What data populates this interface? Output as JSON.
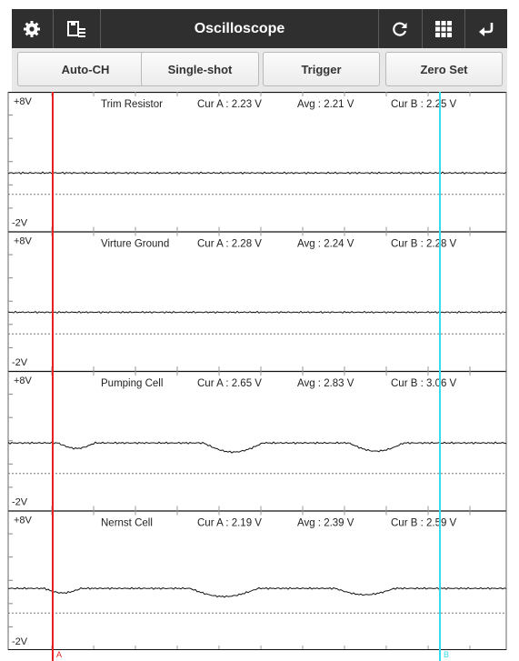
{
  "app": {
    "title": "Oscilloscope"
  },
  "toolbar": {
    "settings_icon": "gear-icon",
    "save_icon": "save-list-icon",
    "refresh_icon": "refresh-icon",
    "grid_icon": "grid-icon",
    "back_icon": "return-arrow-icon"
  },
  "buttons": {
    "auto_ch": "Auto-CH",
    "single_shot": "Single-shot",
    "trigger": "Trigger",
    "zero_set": "Zero Set"
  },
  "cursor_labels": {
    "a": "A",
    "b": "B"
  },
  "colors": {
    "cursor_a": "#e82020",
    "cursor_b": "#34dcec",
    "accent": "#35a4c8",
    "topbar": "#2f2f2f"
  },
  "channels": [
    {
      "name": "Trim Resistor",
      "cur_a": "Cur A : 2.23 V",
      "avg": "Avg : 2.21 V",
      "cur_b": "Cur B : 2.25 V",
      "y_max": "+8V",
      "y_min": "-2V"
    },
    {
      "name": "Virture Ground",
      "cur_a": "Cur A : 2.28 V",
      "avg": "Avg : 2.24 V",
      "cur_b": "Cur B : 2.28 V",
      "y_max": "+8V",
      "y_min": "-2V"
    },
    {
      "name": "Pumping Cell",
      "cur_a": "Cur A : 2.65 V",
      "avg": "Avg : 2.83 V",
      "cur_b": "Cur B : 3.06 V",
      "y_max": "+8V",
      "y_min": "-2V"
    },
    {
      "name": "Nernst Cell",
      "cur_a": "Cur A : 2.19 V",
      "avg": "Avg : 2.39 V",
      "cur_b": "Cur B : 2.59 V",
      "y_max": "+8V",
      "y_min": "-2V"
    }
  ]
}
